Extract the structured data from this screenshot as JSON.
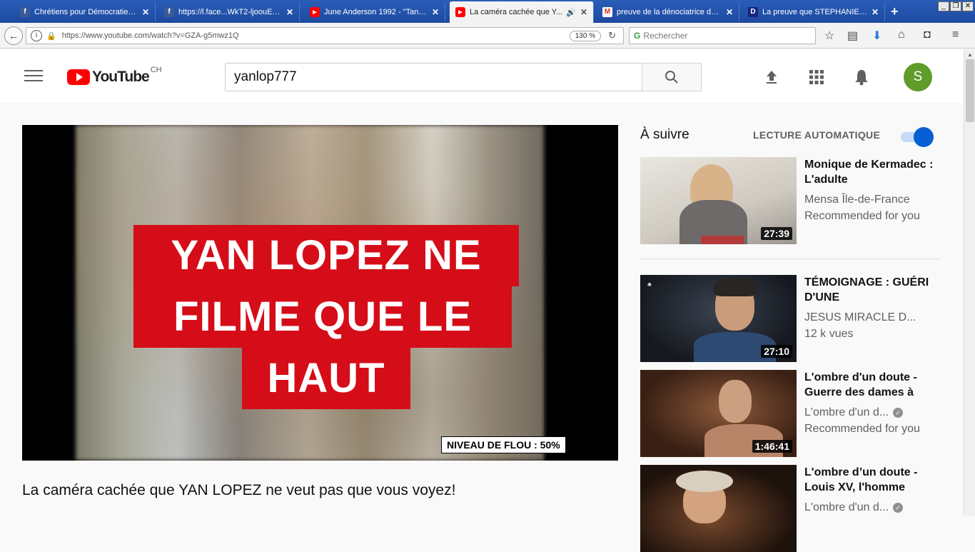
{
  "browser": {
    "tabs": [
      {
        "label": "Chrétiens pour Démocratie dir...",
        "icon": "facebook-icon"
      },
      {
        "label": "https://l.face...WkT2-ljoouE2Q",
        "icon": "facebook-icon"
      },
      {
        "label": "June Anderson 1992 - \"Tanti ...",
        "icon": "youtube-icon"
      },
      {
        "label": "La caméra cachée que Y...",
        "icon": "youtube-icon",
        "active": true
      },
      {
        "label": "preuve de la dénociatrice de ...",
        "icon": "gmail-icon"
      },
      {
        "label": "La preuve que STEPHANIE ...",
        "icon": "dailymotion-icon"
      }
    ],
    "url": "https://www.youtube.com/watch?v=GZA-g5mwz1Q",
    "zoom": "130 %",
    "search_placeholder": "Rechercher"
  },
  "youtube": {
    "logo_text": "YouTube",
    "country": "CH",
    "search_query": "yanlop777",
    "avatar_letter": "S"
  },
  "video": {
    "overlay_line1": "YAN LOPEZ NE",
    "overlay_line2": "FILME QUE LE",
    "overlay_line3": "HAUT",
    "blur_label": "NIVEAU DE FLOU : 50%",
    "title": "La caméra cachée que YAN LOPEZ ne veut pas que vous voyez!"
  },
  "sidebar": {
    "up_next": "À suivre",
    "autoplay_label": "LECTURE AUTOMATIQUE",
    "autoplay_on": true,
    "accent_color": "#065fd4",
    "recommendations": [
      {
        "title": "Monique de Kermadec : L'adulte",
        "channel": "Mensa Île-de-France",
        "meta": "Recommended for you",
        "duration": "27:39",
        "verified": false
      },
      {
        "title": "TÉMOIGNAGE : GUÉRI D'UNE",
        "channel": "JESUS MIRACLE D...",
        "meta": "12 k vues",
        "duration": "27:10",
        "verified": false
      },
      {
        "title": "L'ombre d'un doute - Guerre des dames à",
        "channel": "L'ombre d'un d...",
        "meta": "Recommended for you",
        "duration": "1:46:41",
        "verified": true
      },
      {
        "title": "L'ombre d’un doute - Louis XV, l'homme",
        "channel": "L'ombre d'un d...",
        "meta": "",
        "duration": "",
        "verified": true
      }
    ]
  }
}
